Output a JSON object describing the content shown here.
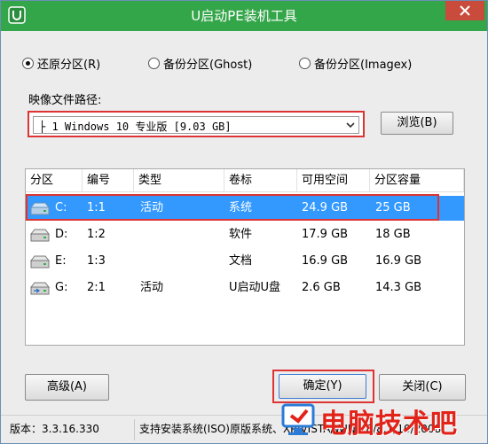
{
  "window": {
    "title": "U启动PE装机工具"
  },
  "modes": [
    {
      "label": "还原分区(R)",
      "checked": true
    },
    {
      "label": "备份分区(Ghost)",
      "checked": false
    },
    {
      "label": "备份分区(Imagex)",
      "checked": false
    }
  ],
  "image_path": {
    "label": "映像文件路径:",
    "selected": "├ 1 Windows 10 专业版 [9.03 GB]",
    "browse_label": "浏览(B)"
  },
  "partition_table": {
    "columns": [
      "分区",
      "编号",
      "类型",
      "卷标",
      "可用空间",
      "分区容量"
    ],
    "rows": [
      {
        "drive": "C:",
        "id": "1:1",
        "type": "活动",
        "label": "系统",
        "free": "24.9 GB",
        "size": "25 GB",
        "selected": true
      },
      {
        "drive": "D:",
        "id": "1:2",
        "type": "",
        "label": "软件",
        "free": "17.9 GB",
        "size": "18 GB",
        "selected": false
      },
      {
        "drive": "E:",
        "id": "1:3",
        "type": "",
        "label": "文档",
        "free": "16.9 GB",
        "size": "16.9 GB",
        "selected": false
      },
      {
        "drive": "G:",
        "id": "2:1",
        "type": "活动",
        "label": "U启动U盘",
        "free": "2.6 GB",
        "size": "14.3 GB",
        "selected": false
      }
    ]
  },
  "buttons": {
    "advanced": "高级(A)",
    "ok": "确定(Y)",
    "close": "关闭(C)"
  },
  "statusbar": {
    "version": "版本：3.3.16.330",
    "support": "支持安装系统(ISO)原版系统、XP/VISTA/WIN7/8/8.1/10/2008"
  },
  "watermark": {
    "text": "电脑技术吧"
  },
  "colors": {
    "titlebar": "#34a64a",
    "selection": "#3399ff",
    "highlight_box": "#dd3333",
    "watermark": "#e2231a"
  }
}
